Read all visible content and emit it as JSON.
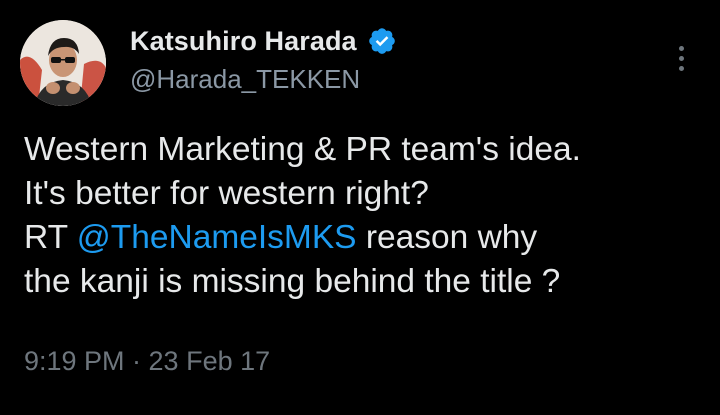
{
  "author": {
    "display_name": "Katsuhiro Harada",
    "handle": "@Harada_TEKKEN",
    "verified": true,
    "avatar_icon": "profile-photo"
  },
  "tweet": {
    "line1": "Western Marketing & PR team's idea.",
    "line2": "It's better for western right?",
    "line3_prefix": "RT",
    "mention": "@TheNameIsMKS",
    "line3_suffix": "reason why",
    "line4": "the kanji is missing behind the title ?",
    "timestamp": "9:19 PM · 23 Feb 17"
  },
  "colors": {
    "background": "#000000",
    "text": "#e7e9ea",
    "secondary": "#6e767d",
    "accent": "#1d9bf0"
  },
  "icons": {
    "verified": "verified-badge-icon",
    "more": "more-options-icon"
  }
}
